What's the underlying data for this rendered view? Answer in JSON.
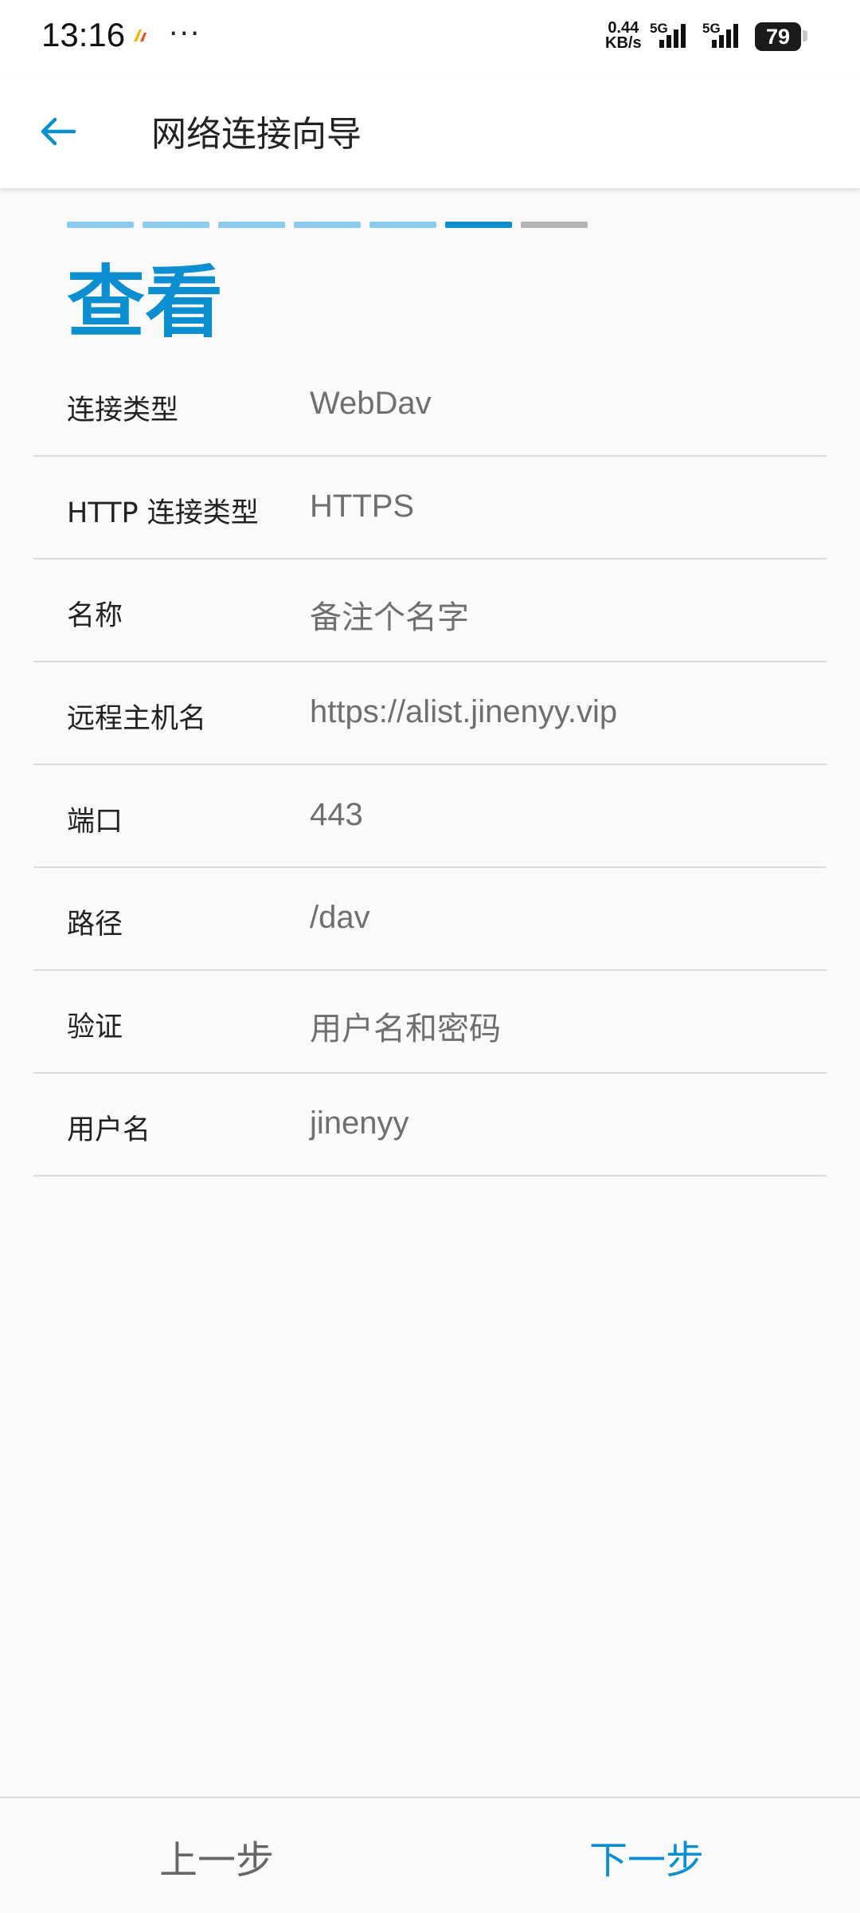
{
  "status_bar": {
    "time": "13:16",
    "more": "···",
    "net_speed_value": "0.44",
    "net_speed_unit": "KB/s",
    "signal1": "5G",
    "signal2": "5G",
    "battery": "79"
  },
  "app_bar": {
    "title": "网络连接向导"
  },
  "progress": {
    "total_steps": 7,
    "current_step": 6,
    "colors": {
      "done": "#8ccbec",
      "current": "#0b8fd1",
      "pending": "#b5b5b5"
    }
  },
  "page": {
    "heading": "查看"
  },
  "fields": [
    {
      "label": "连接类型",
      "value": "WebDav"
    },
    {
      "label": "HTTP 连接类型",
      "value": "HTTPS"
    },
    {
      "label": "名称",
      "value": "备注个名字"
    },
    {
      "label": "远程主机名",
      "value": "https://alist.jinenyy.vip"
    },
    {
      "label": "端口",
      "value": "443"
    },
    {
      "label": "路径",
      "value": "/dav"
    },
    {
      "label": "验证",
      "value": "用户名和密码"
    },
    {
      "label": "用户名",
      "value": "jinenyy"
    }
  ],
  "bottom_bar": {
    "prev_label": "上一步",
    "next_label": "下一步"
  },
  "colors": {
    "accent": "#0b8fd1"
  }
}
